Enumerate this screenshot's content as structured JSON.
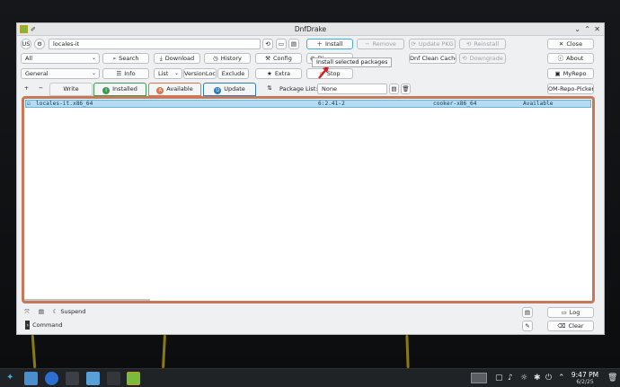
{
  "window": {
    "title": "DnfDrake"
  },
  "toolbar_row1": {
    "us_label": "US",
    "search_value": "locales-it",
    "install": "Install",
    "remove": "Remove",
    "update_pkg": "Update PKG",
    "reinstall": "Reinstall",
    "close": "Close"
  },
  "toolbar_row2": {
    "filter_value": "All",
    "search": "Search",
    "download": "Download",
    "history": "History",
    "config": "Config",
    "di_partial": "Di",
    "dnf_clean_cache": "Dnf Clean Cache",
    "downgrade": "Downgrade",
    "about": "About"
  },
  "toolbar_row3": {
    "group_value": "General",
    "info": "Info",
    "list_value": "List",
    "versionlock": "VersionLock",
    "exclude": "Exclude",
    "extra": "Extra",
    "stop": "Stop",
    "myrepo": "MyRepo"
  },
  "tabs_row": {
    "add": "+",
    "minus": "−",
    "write": "Write",
    "installed": "Installed",
    "available": "Available",
    "update": "Update",
    "package_list_label": "Package List:",
    "package_list_value": "None",
    "om_repo_picker": "OM-Repo-Picker"
  },
  "tooltip": "Install selected packages",
  "packages": [
    {
      "name": "locales-it.x86_64",
      "version": "6:2.41-2",
      "repo": "cooker-x86_64",
      "status": "Available"
    }
  ],
  "bottom": {
    "suspend": "Suspend",
    "log": "Log",
    "command": "Command",
    "clear": "Clear"
  },
  "taskbar": {
    "time": "9:47 PM",
    "date": "6/2/25"
  },
  "colors": {
    "installed_tab": "#3d9a50",
    "available_tab": "#d5784f",
    "update_tab": "#2e7fb8",
    "selection": "#b5dcf2"
  }
}
